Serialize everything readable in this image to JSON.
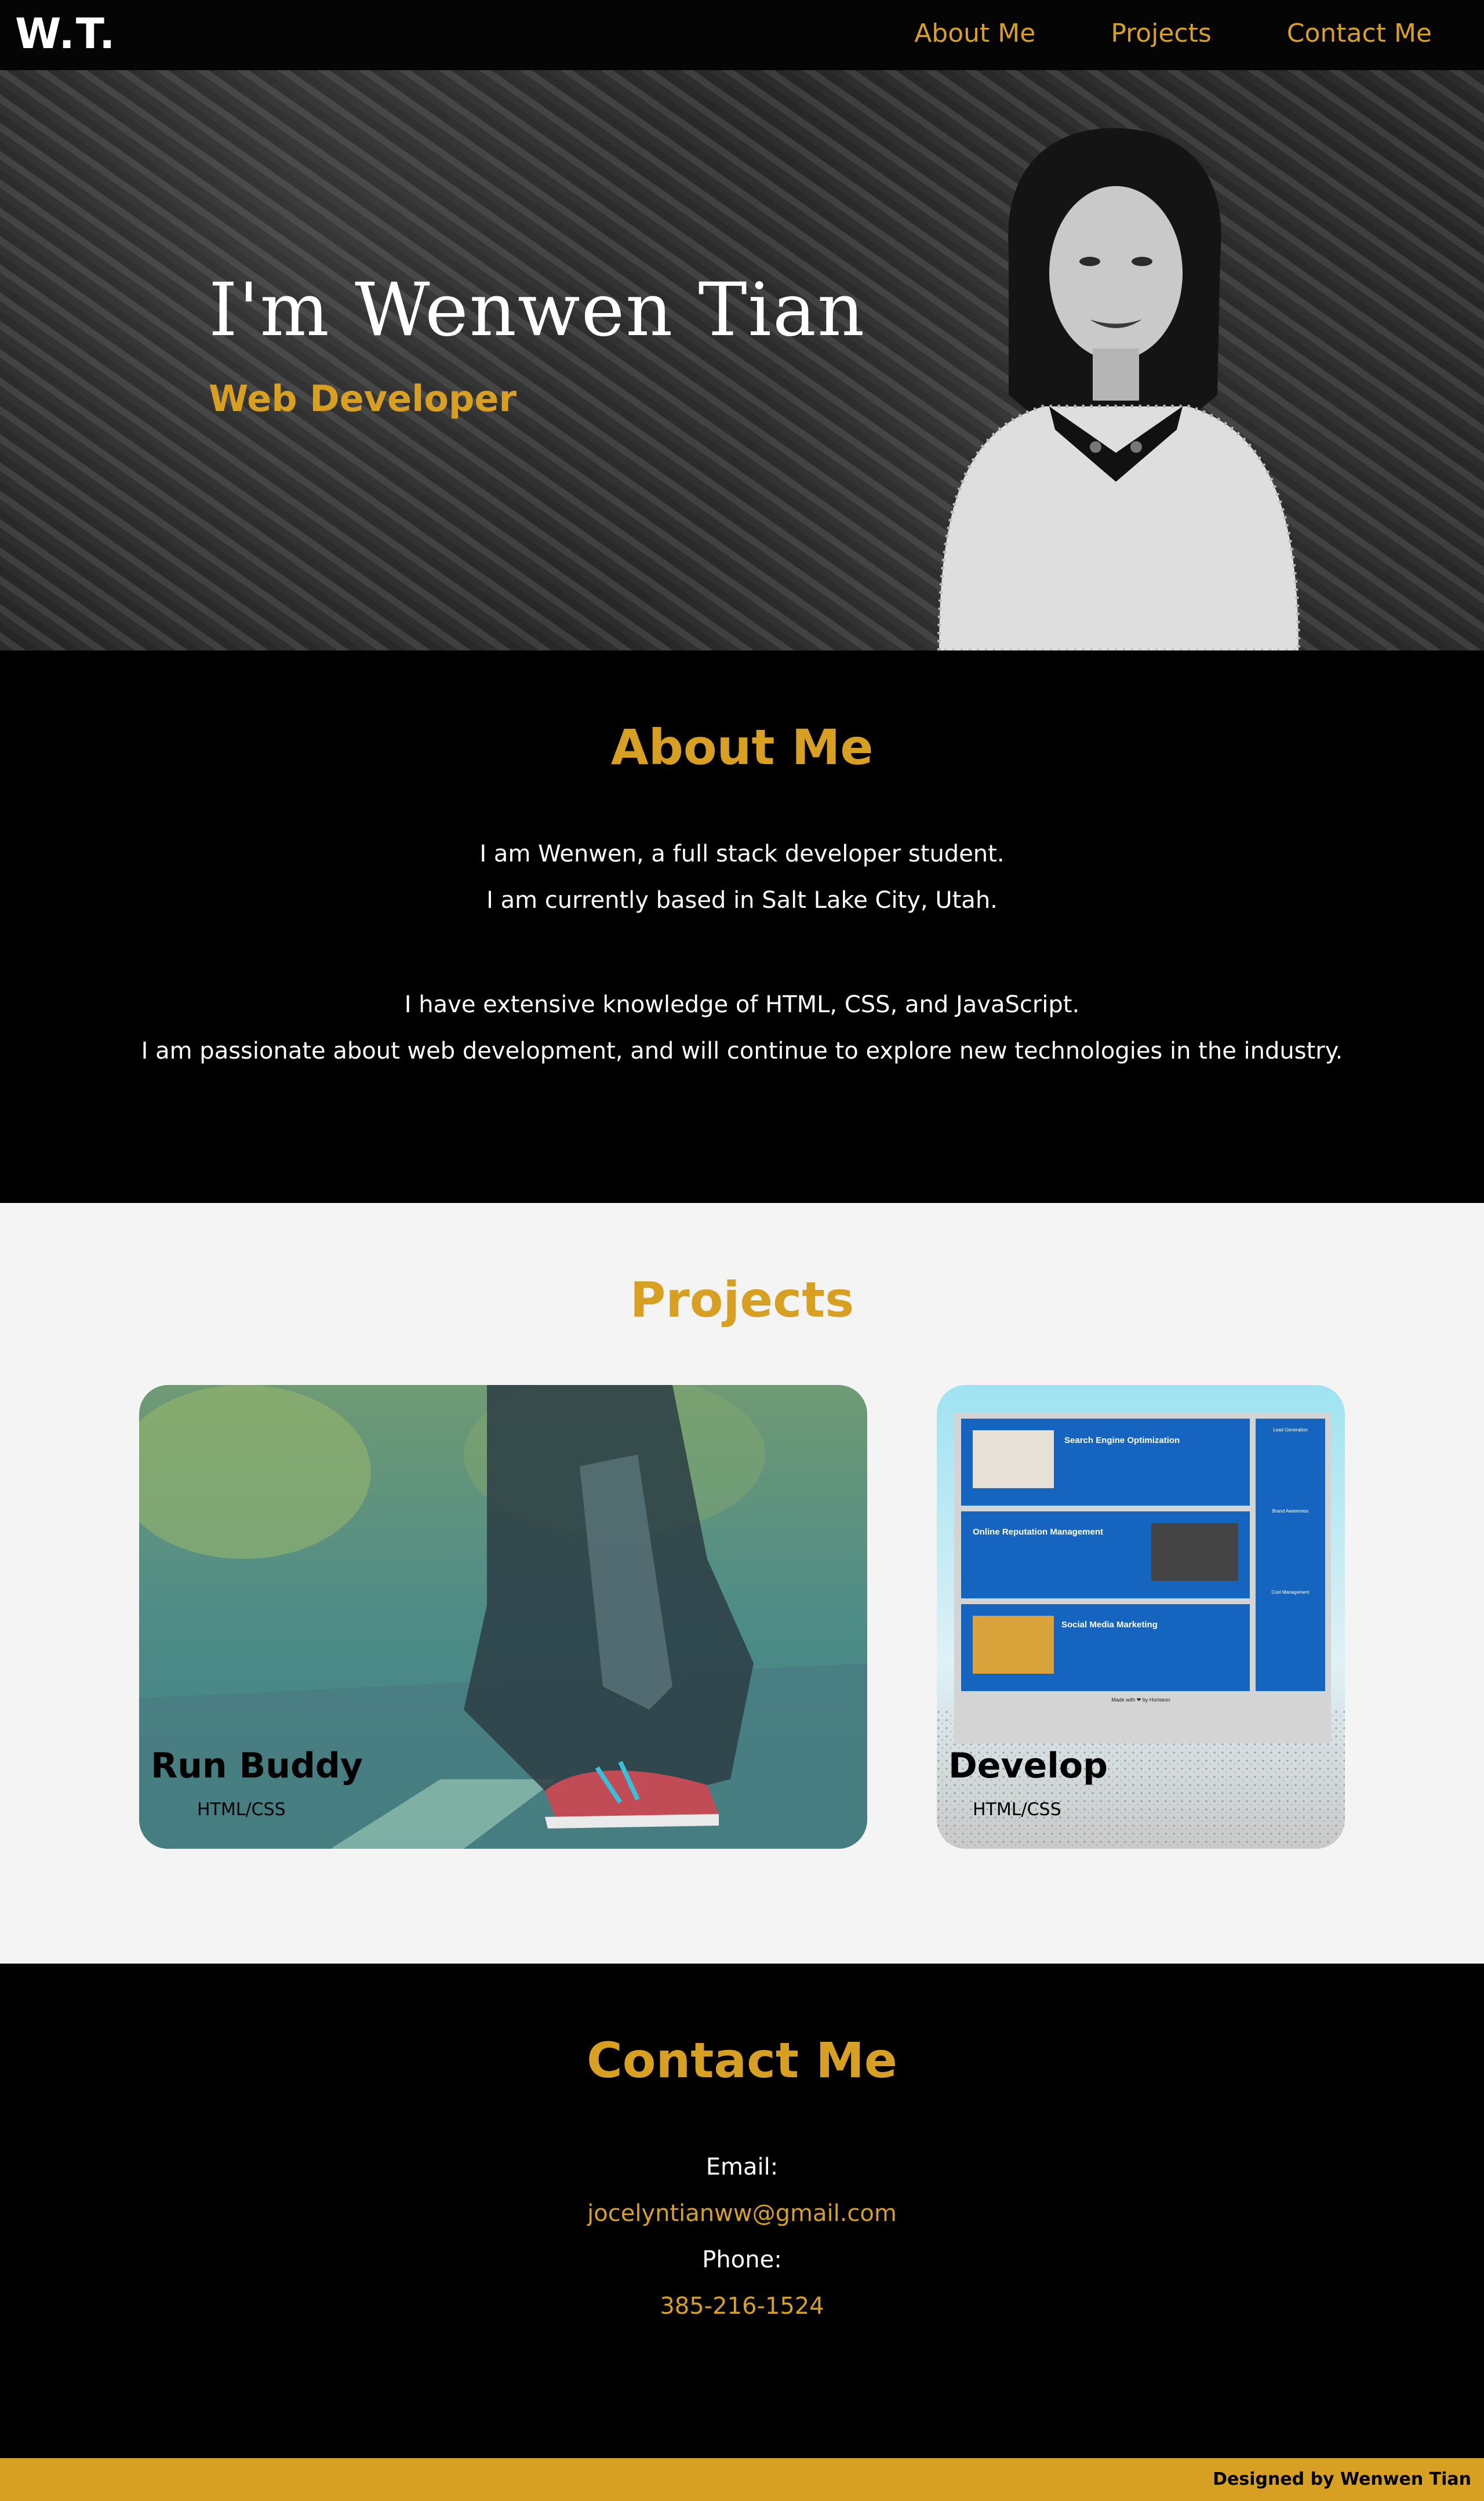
{
  "brand": {
    "logo": "W.T.",
    "accent_color": "#d8a022"
  },
  "nav": {
    "items": [
      {
        "label": "About Me"
      },
      {
        "label": "Projects"
      },
      {
        "label": "Contact Me"
      }
    ]
  },
  "hero": {
    "title": "I'm Wenwen Tian",
    "subtitle": "Web Developer"
  },
  "about": {
    "title": "About Me",
    "lines": [
      "I am Wenwen, a full stack developer student.",
      "I am currently based in Salt Lake City, Utah.",
      "I have extensive knowledge of HTML, CSS, and JavaScript.",
      "I am passionate about web development, and will continue to explore new technologies in the industry."
    ]
  },
  "projects": {
    "title": "Projects",
    "items": [
      {
        "name": "Run Buddy",
        "tech": "HTML/CSS"
      },
      {
        "name": "Develop",
        "tech": "HTML/CSS"
      }
    ],
    "develop_preview": {
      "rows": [
        {
          "heading": "Search Engine Optimization"
        },
        {
          "heading": "Online Reputation Management"
        },
        {
          "heading": "Social Media Marketing"
        }
      ],
      "side": [
        "Lead Generation",
        "Brand Awareness",
        "Cost Management"
      ],
      "footer": "Made with ❤ by Horiseon"
    }
  },
  "contact": {
    "title": "Contact Me",
    "email_label": "Email:",
    "email": "jocelyntianww@gmail.com",
    "phone_label": "Phone:",
    "phone": "385-216-1524"
  },
  "footer": {
    "credit": "Designed by Wenwen Tian"
  }
}
